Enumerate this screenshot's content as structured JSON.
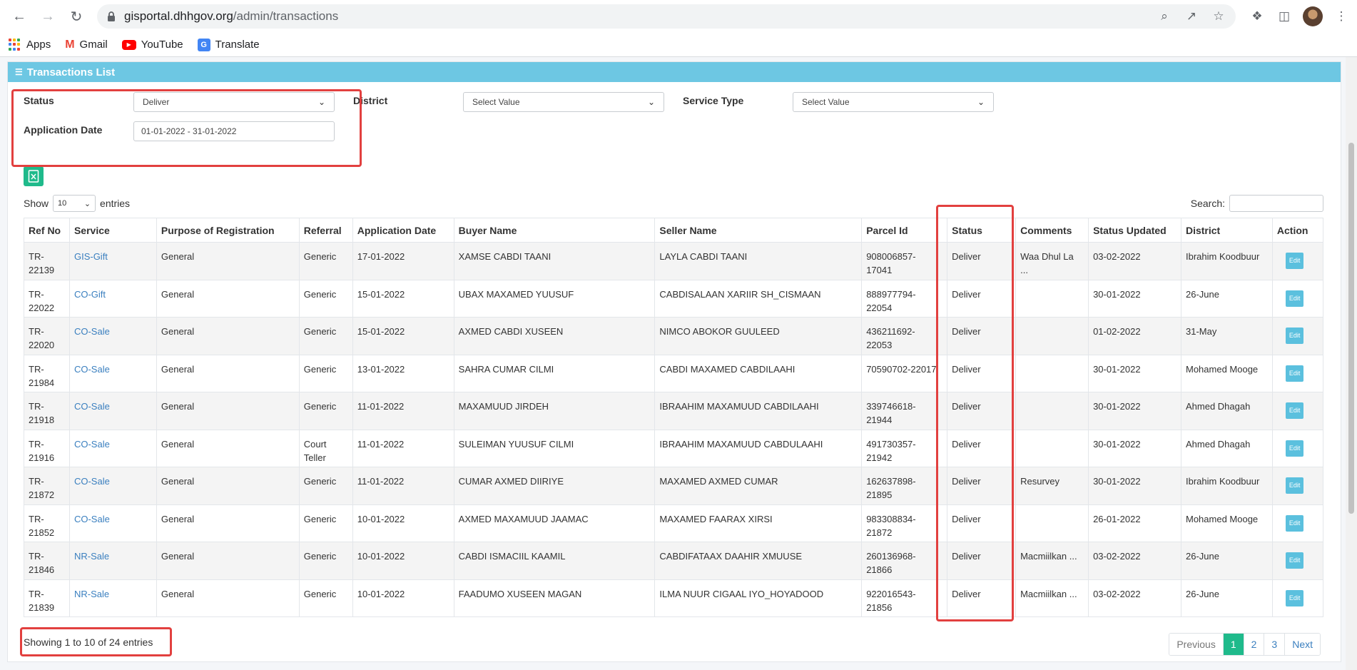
{
  "browser": {
    "url_host": "gisportal.dhhgov.org",
    "url_path": "/admin/transactions",
    "bookmarks": [
      "Apps",
      "Gmail",
      "YouTube",
      "Translate"
    ]
  },
  "card": {
    "title": "Transactions List"
  },
  "filters": {
    "status_label": "Status",
    "status_value": "Deliver",
    "district_label": "District",
    "district_value": "Select Value",
    "service_type_label": "Service Type",
    "service_type_value": "Select Value",
    "app_date_label": "Application Date",
    "app_date_value": "01-01-2022 - 31-01-2022"
  },
  "table_controls": {
    "show_label": "Show",
    "show_value": "10",
    "entries_label": "entries",
    "search_label": "Search:"
  },
  "columns": [
    "Ref No",
    "Service",
    "Purpose of Registration",
    "Referral",
    "Application Date",
    "Buyer Name",
    "Seller Name",
    "Parcel Id",
    "Status",
    "Comments",
    "Status Updated",
    "District",
    "Action"
  ],
  "rows": [
    {
      "ref": "TR-\n22139",
      "service": "GIS-Gift",
      "purpose": "General",
      "referral": "Generic",
      "app_date": "17-01-2022",
      "buyer": "XAMSE CABDI TAANI",
      "seller": "LAYLA CABDI TAANI",
      "parcel": "908006857-\n17041",
      "status": "Deliver",
      "comments": "Waa Dhul La ...",
      "updated": "03-02-2022",
      "district": "Ibrahim Koodbuur",
      "action": "Edit"
    },
    {
      "ref": "TR-\n22022",
      "service": "CO-Gift",
      "purpose": "General",
      "referral": "Generic",
      "app_date": "15-01-2022",
      "buyer": "UBAX MAXAMED YUUSUF",
      "seller": "CABDISALAAN XARIIR SH_CISMAAN",
      "parcel": "888977794-\n22054",
      "status": "Deliver",
      "comments": "",
      "updated": "30-01-2022",
      "district": "26-June",
      "action": "Edit"
    },
    {
      "ref": "TR-\n22020",
      "service": "CO-Sale",
      "purpose": "General",
      "referral": "Generic",
      "app_date": "15-01-2022",
      "buyer": "AXMED CABDI XUSEEN",
      "seller": "NIMCO ABOKOR GUULEED",
      "parcel": "436211692-\n22053",
      "status": "Deliver",
      "comments": "",
      "updated": "01-02-2022",
      "district": "31-May",
      "action": "Edit"
    },
    {
      "ref": "TR-\n21984",
      "service": "CO-Sale",
      "purpose": "General",
      "referral": "Generic",
      "app_date": "13-01-2022",
      "buyer": "SAHRA CUMAR CILMI",
      "seller": "CABDI MAXAMED CABDILAAHI",
      "parcel": "70590702-22017",
      "status": "Deliver",
      "comments": "",
      "updated": "30-01-2022",
      "district": "Mohamed Mooge",
      "action": "Edit"
    },
    {
      "ref": "TR-\n21918",
      "service": "CO-Sale",
      "purpose": "General",
      "referral": "Generic",
      "app_date": "11-01-2022",
      "buyer": "MAXAMUUD JIRDEH",
      "seller": "IBRAAHIM MAXAMUUD CABDILAAHI",
      "parcel": "339746618-\n21944",
      "status": "Deliver",
      "comments": "",
      "updated": "30-01-2022",
      "district": "Ahmed Dhagah",
      "action": "Edit"
    },
    {
      "ref": "TR-\n21916",
      "service": "CO-Sale",
      "purpose": "General",
      "referral": "Court\nTeller",
      "app_date": "11-01-2022",
      "buyer": "SULEIMAN YUUSUF CILMI",
      "seller": "IBRAAHIM MAXAMUUD CABDULAAHI",
      "parcel": "491730357-\n21942",
      "status": "Deliver",
      "comments": "",
      "updated": "30-01-2022",
      "district": "Ahmed Dhagah",
      "action": "Edit"
    },
    {
      "ref": "TR-\n21872",
      "service": "CO-Sale",
      "purpose": "General",
      "referral": "Generic",
      "app_date": "11-01-2022",
      "buyer": "CUMAR AXMED DIIRIYE",
      "seller": "MAXAMED AXMED CUMAR",
      "parcel": "162637898-\n21895",
      "status": "Deliver",
      "comments": "Resurvey",
      "updated": "30-01-2022",
      "district": "Ibrahim Koodbuur",
      "action": "Edit"
    },
    {
      "ref": "TR-\n21852",
      "service": "CO-Sale",
      "purpose": "General",
      "referral": "Generic",
      "app_date": "10-01-2022",
      "buyer": "AXMED MAXAMUUD JAAMAC",
      "seller": "MAXAMED FAARAX XIRSI",
      "parcel": "983308834-\n21872",
      "status": "Deliver",
      "comments": "",
      "updated": "26-01-2022",
      "district": "Mohamed Mooge",
      "action": "Edit"
    },
    {
      "ref": "TR-\n21846",
      "service": "NR-Sale",
      "purpose": "General",
      "referral": "Generic",
      "app_date": "10-01-2022",
      "buyer": "CABDI ISMACIIL KAAMIL",
      "seller": "CABDIFATAAX DAAHIR XMUUSE",
      "parcel": "260136968-\n21866",
      "status": "Deliver",
      "comments": "Macmiilkan ...",
      "updated": "03-02-2022",
      "district": "26-June",
      "action": "Edit"
    },
    {
      "ref": "TR-\n21839",
      "service": "NR-Sale",
      "purpose": "General",
      "referral": "Generic",
      "app_date": "10-01-2022",
      "buyer": "FAADUMO XUSEEN MAGAN",
      "seller": "ILMA NUUR CIGAAL IYO_HOYADOOD",
      "parcel": "922016543-\n21856",
      "status": "Deliver",
      "comments": "Macmiilkan ...",
      "updated": "03-02-2022",
      "district": "26-June",
      "action": "Edit"
    }
  ],
  "footer": {
    "showing": "Showing 1 to 10 of 24 entries",
    "pager": [
      "Previous",
      "1",
      "2",
      "3",
      "Next"
    ],
    "active_page": "1"
  },
  "colors": {
    "header": "#6dc7e3",
    "accent": "#1fba8b",
    "link": "#3a7fbf",
    "highlight": "#e2403f"
  }
}
